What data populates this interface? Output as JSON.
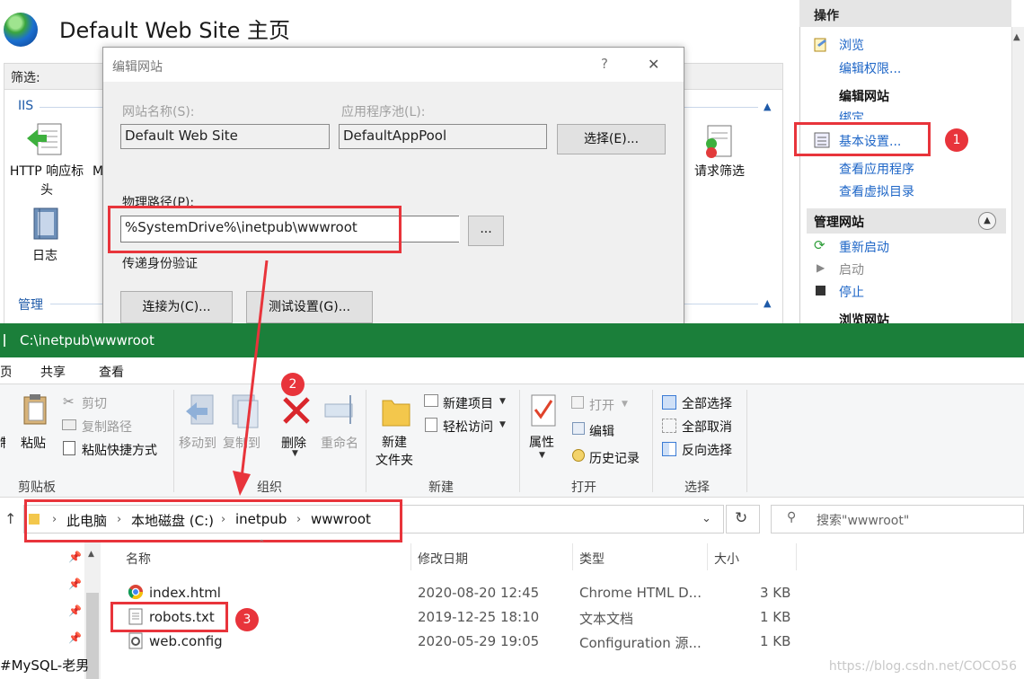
{
  "iis": {
    "title": "Default Web Site 主页",
    "filter_label": "筛选:",
    "group_iis": "IIS",
    "group_manage": "管理",
    "features": [
      {
        "label1": "HTTP 响应标",
        "label2": "头"
      },
      {
        "label1": "日志",
        "label2": ""
      },
      {
        "label1": "请求筛选",
        "label2": ""
      }
    ],
    "partial_feature": "M",
    "actions": {
      "header": "操作",
      "browse": "浏览",
      "edit_permissions": "编辑权限...",
      "edit_site_header": "编辑网站",
      "bindings": "绑定",
      "basic_settings": "基本设置...",
      "view_apps": "查看应用程序",
      "view_vdirs": "查看虚拟目录",
      "manage_site_header": "管理网站",
      "restart": "重新启动",
      "start": "启动",
      "stop": "停止",
      "browse_site_header": "浏览网站"
    }
  },
  "dialog": {
    "title": "编辑网站",
    "help": "?",
    "close": "✕",
    "site_name_label": "网站名称(S):",
    "site_name_value": "Default Web Site",
    "app_pool_label": "应用程序池(L):",
    "app_pool_value": "DefaultAppPool",
    "select_button": "选择(E)...",
    "physical_path_label": "物理路径(P):",
    "physical_path_value": "%SystemDrive%\\inetpub\\wwwroot",
    "browse_button": "...",
    "pass_auth_label": "传递身份验证",
    "connect_as_button": "连接为(C)...",
    "test_settings_button": "测试设置(G)..."
  },
  "explorer": {
    "title_path": "C:\\inetpub\\wwwroot",
    "tabs": [
      "页",
      "共享",
      "查看"
    ],
    "clipboard": {
      "paste": "粘贴",
      "cut": "剪切",
      "copy_path": "复制路径",
      "paste_shortcut": "粘贴快捷方式",
      "group": "剪贴板",
      "partial_left": "制"
    },
    "organize": {
      "move_to": "移动到",
      "copy_to": "复制到",
      "delete": "删除",
      "rename": "重命名",
      "group": "组织"
    },
    "new": {
      "new_folder_1": "新建",
      "new_folder_2": "文件夹",
      "new_item": "新建项目",
      "easy_access": "轻松访问",
      "group": "新建"
    },
    "open": {
      "properties": "属性",
      "open": "打开",
      "edit": "编辑",
      "history": "历史记录",
      "group": "打开"
    },
    "select": {
      "select_all": "全部选择",
      "select_none": "全部取消",
      "invert": "反向选择",
      "group": "选择"
    },
    "breadcrumb": [
      "此电脑",
      "本地磁盘 (C:)",
      "inetpub",
      "wwwroot"
    ],
    "search_placeholder": "搜索\"wwwroot\"",
    "columns": [
      "名称",
      "修改日期",
      "类型",
      "大小"
    ],
    "files": [
      {
        "name": "index.html",
        "date": "2020-08-20 12:45",
        "type": "Chrome HTML D...",
        "size": "3 KB"
      },
      {
        "name": "robots.txt",
        "date": "2019-12-25 18:10",
        "type": "文本文档",
        "size": "1 KB"
      },
      {
        "name": "web.config",
        "date": "2020-05-29 19:05",
        "type": "Configuration 源...",
        "size": "1 KB"
      }
    ]
  },
  "annotations": {
    "badge1": "1",
    "badge2": "2",
    "badge3": "3"
  },
  "left_bottom_text": "#MySQL-老男",
  "watermark": "https://blog.csdn.net/COCO56",
  "colors": {
    "accent_red": "#e8343b",
    "explorer_green": "#1b7f3a",
    "link_blue": "#1e66c7"
  }
}
